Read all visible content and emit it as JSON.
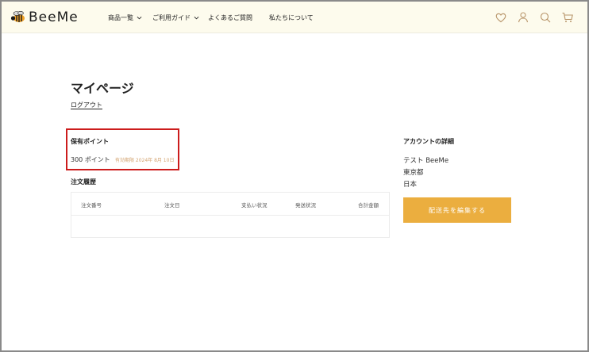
{
  "brand": {
    "name": "BeeMe",
    "accent": "#ebae3f",
    "header_bg": "#fdfbed",
    "highlight": "#cc1c1c"
  },
  "nav": [
    {
      "label": "商品一覧",
      "dropdown": true
    },
    {
      "label": "ご利用ガイド",
      "dropdown": true
    },
    {
      "label": "よくあるご質問",
      "dropdown": false
    },
    {
      "label": "私たちについて",
      "dropdown": false
    }
  ],
  "header_icons": [
    "heart-icon",
    "user-icon",
    "search-icon",
    "cart-icon"
  ],
  "page": {
    "title": "マイページ",
    "logout": "ログアウト"
  },
  "points": {
    "heading": "保有ポイント",
    "value": "300 ポイント",
    "expiry": "有効期限 2024年 8月 10日"
  },
  "orders": {
    "heading": "注文履歴",
    "columns": [
      "注文番号",
      "注文日",
      "支払い状況",
      "発送状況",
      "合計金額"
    ]
  },
  "account": {
    "heading": "アカウントの詳細",
    "name": "テスト BeeMe",
    "city": "東京都",
    "country": "日本",
    "edit_button": "配送先を編集する"
  }
}
